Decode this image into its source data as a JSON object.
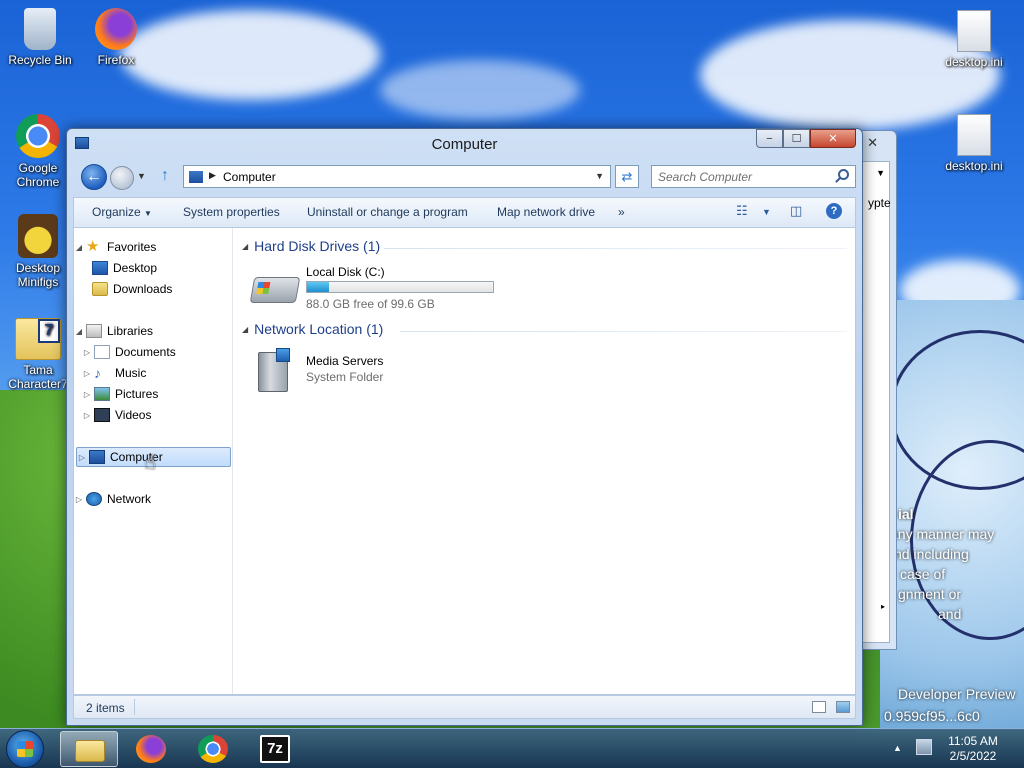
{
  "desktop": {
    "icons": [
      {
        "label": "Recycle Bin"
      },
      {
        "label": "Firefox"
      },
      {
        "label": "Google Chrome"
      },
      {
        "label": "Desktop Minifigs"
      },
      {
        "label": "Tama Character7"
      },
      {
        "label": "desktop.ini"
      },
      {
        "label": "desktop.ini"
      }
    ]
  },
  "background_window": {
    "partial_label": "ypte"
  },
  "wallpaper_text": {
    "line1": "ial",
    "line2": "any manner may",
    "line3": "nd including",
    "line4": "case of",
    "line5": "gnment or",
    "line6": "and",
    "line7": "Developer Preview",
    "line8": "0.959cf95...6c0"
  },
  "window": {
    "title": "Computer",
    "address": "Computer",
    "search_placeholder": "Search Computer",
    "caption": {
      "minimize": "−",
      "maximize": "☐",
      "close": "✕"
    },
    "commands": {
      "organize": "Organize",
      "system_properties": "System properties",
      "uninstall": "Uninstall or change a program",
      "map_drive": "Map network drive",
      "more": "»"
    },
    "nav": {
      "favorites": "Favorites",
      "desktop": "Desktop",
      "downloads": "Downloads",
      "libraries": "Libraries",
      "documents": "Documents",
      "music": "Music",
      "pictures": "Pictures",
      "videos": "Videos",
      "computer": "Computer",
      "network": "Network"
    },
    "groups": {
      "hdd": "Hard Disk Drives (1)",
      "network": "Network Location (1)"
    },
    "drive": {
      "name": "Local Disk (C:)",
      "free_text": "88.0 GB free of 99.6 GB",
      "used_fraction": 0.116
    },
    "media": {
      "name": "Media Servers",
      "type": "System Folder"
    },
    "status": {
      "items": "2 items"
    }
  },
  "taskbar": {
    "time": "11:05 AM",
    "date": "2/5/2022",
    "apps": [
      "File Explorer",
      "Firefox",
      "Google Chrome",
      "7-Zip"
    ],
    "sevenzip_label": "7z"
  },
  "colors": {
    "accent": "#1e3f8a",
    "selection": "#c1dcfc",
    "drive_fill": "#1f8fd0"
  }
}
